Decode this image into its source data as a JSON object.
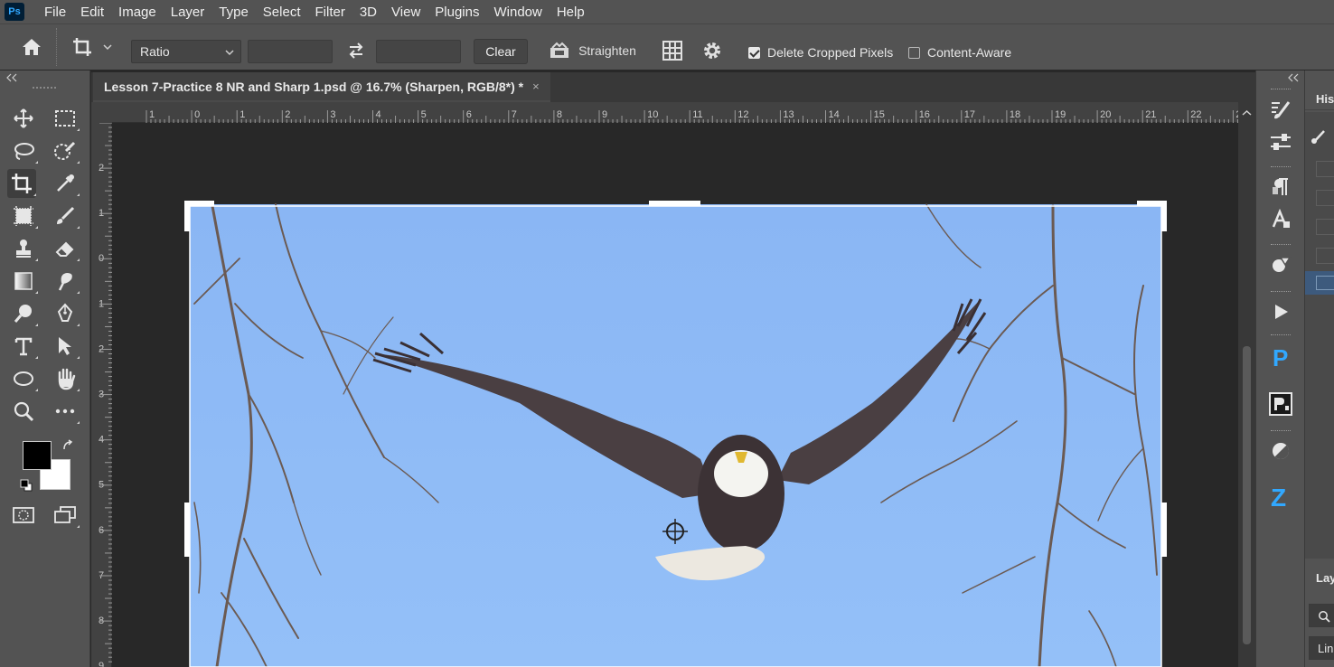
{
  "app": {
    "logo": "Ps"
  },
  "menu": [
    "File",
    "Edit",
    "Image",
    "Layer",
    "Type",
    "Select",
    "Filter",
    "3D",
    "View",
    "Plugins",
    "Window",
    "Help"
  ],
  "options": {
    "ratio_select": "Ratio",
    "width_value": "",
    "height_value": "",
    "clear_label": "Clear",
    "straighten_label": "Straighten",
    "delete_cropped_label": "Delete Cropped Pixels",
    "delete_cropped_checked": true,
    "content_aware_label": "Content-Aware",
    "content_aware_checked": false
  },
  "document": {
    "tab_title": "Lesson 7-Practice 8 NR and Sharp 1.psd @ 16.7% (Sharpen, RGB/8*) *",
    "close_glyph": "×"
  },
  "rulers": {
    "horizontal": [
      "1",
      "0",
      "1",
      "2",
      "3",
      "4",
      "5",
      "6",
      "7",
      "8",
      "9",
      "10",
      "11",
      "12",
      "13",
      "14",
      "15",
      "16",
      "17",
      "18",
      "19",
      "20",
      "21",
      "22",
      "2"
    ],
    "vertical": [
      "2",
      "1",
      "0",
      "1",
      "2",
      "3",
      "4",
      "5",
      "6",
      "7",
      "8",
      "9"
    ]
  },
  "right_panels": {
    "history_title": "His",
    "layers_title": "Lay",
    "layers_blend": "Lin"
  },
  "colors": {
    "foreground": "#000000",
    "background": "#ffffff",
    "sky": "#8cb8f4",
    "accent": "#31a8ff"
  }
}
